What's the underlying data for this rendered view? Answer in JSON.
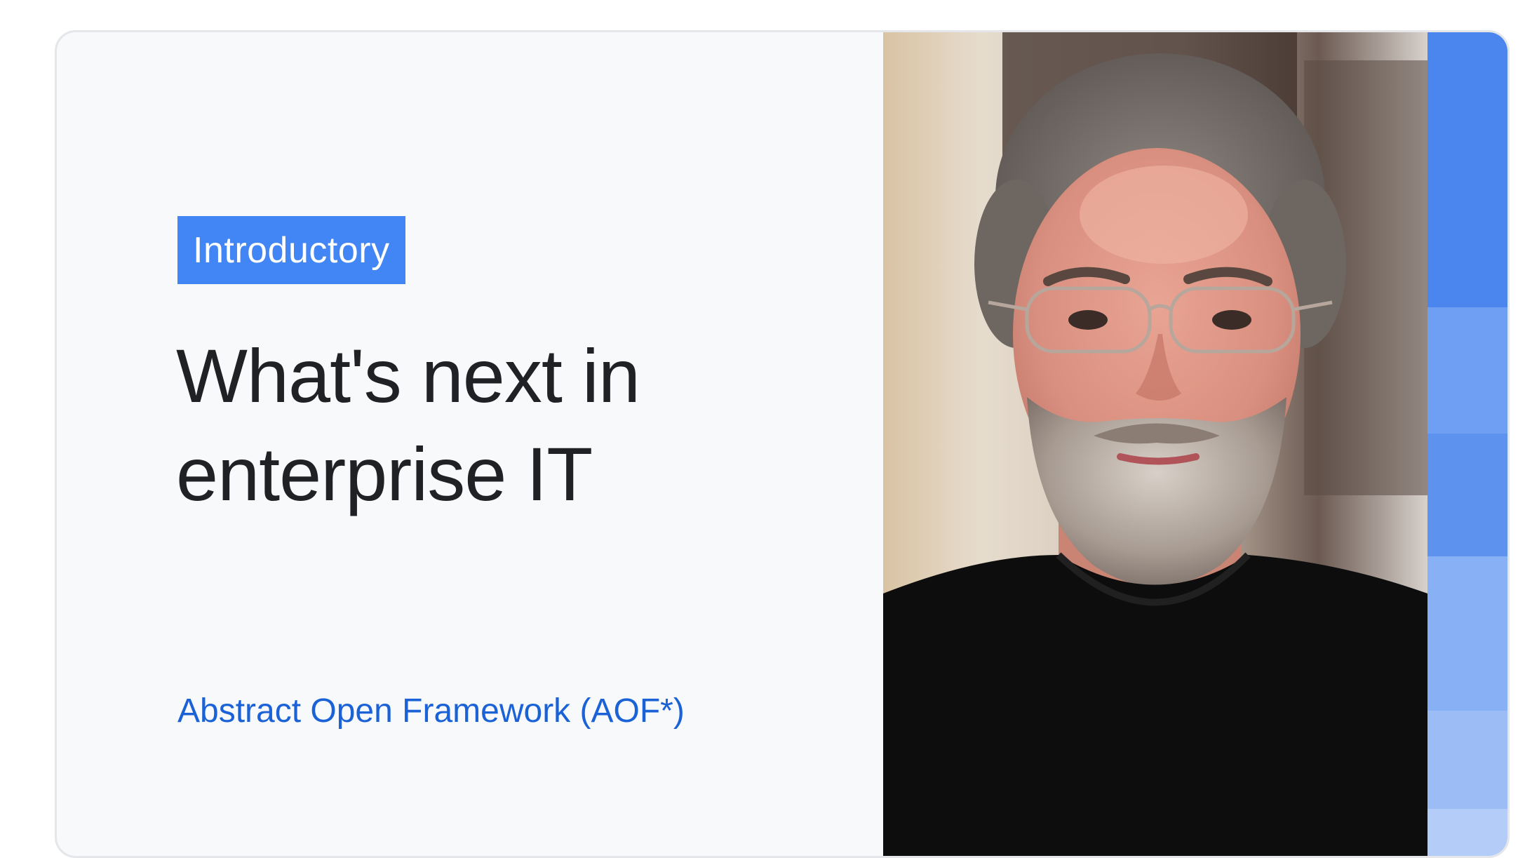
{
  "course": {
    "level_badge": "Introductory",
    "title": "What's next in enterprise IT",
    "framework_link": "Abstract Open Framework (AOF*)"
  },
  "colors": {
    "accent": "#4285f4",
    "link": "#1a62d6",
    "card_background": "#f8f9fb",
    "title_text": "#202124"
  },
  "stripe_colors": [
    "#4a86ee",
    "#6f9ff2",
    "#5e92ef",
    "#88b0f4",
    "#9cbcf6",
    "#b4ccf8"
  ]
}
